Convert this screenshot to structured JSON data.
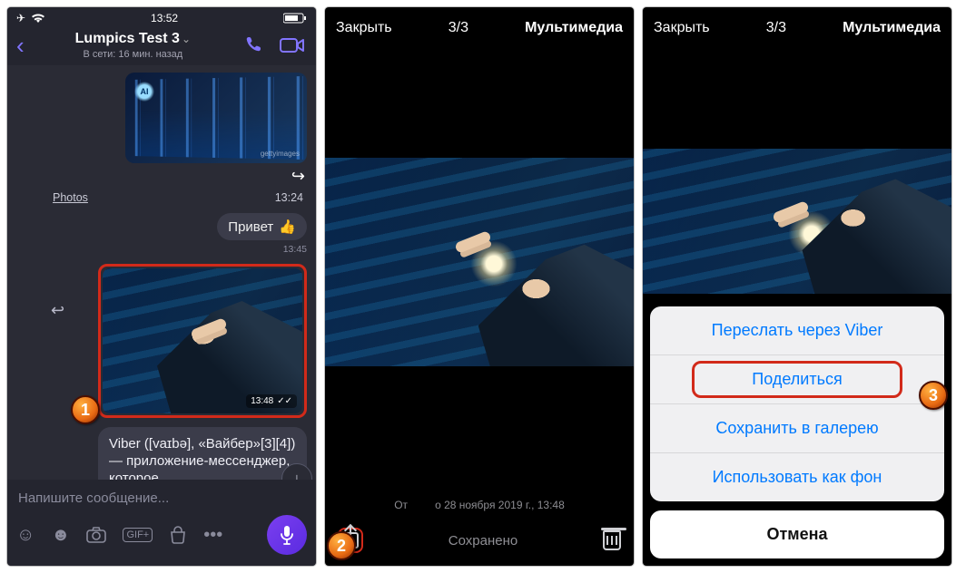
{
  "screen1": {
    "status": {
      "time": "13:52"
    },
    "header": {
      "title": "Lumpics Test 3",
      "presence": "В сети: 16 мин. назад"
    },
    "thumb1": {
      "ai_label": "AI",
      "watermark": "gettyimages"
    },
    "row_meta": {
      "label": "Photos",
      "time": "13:24"
    },
    "msg1": {
      "text": "Привет",
      "time": "13:45"
    },
    "hero_time": "13:48",
    "long_msg": "Viber ([vaɪbə], «Вайбер»[3][4]) — приложение-мессенджер, которое",
    "composer": {
      "placeholder": "Напишите сообщение..."
    }
  },
  "screen2": {
    "close": "Закрыть",
    "counter": "3/3",
    "heading": "Мультимедиа",
    "caption_prefix": "От",
    "caption_rest": "о 28 ноября 2019 г., 13:48",
    "saved": "Сохранено"
  },
  "screen3": {
    "close": "Закрыть",
    "counter": "3/3",
    "heading": "Мультимедиа",
    "sheet": {
      "forward": "Переслать через Viber",
      "share": "Поделиться",
      "save": "Сохранить в галерею",
      "wallpaper": "Использовать как фон",
      "cancel": "Отмена"
    }
  },
  "markers": {
    "m1": "1",
    "m2": "2",
    "m3": "3"
  }
}
